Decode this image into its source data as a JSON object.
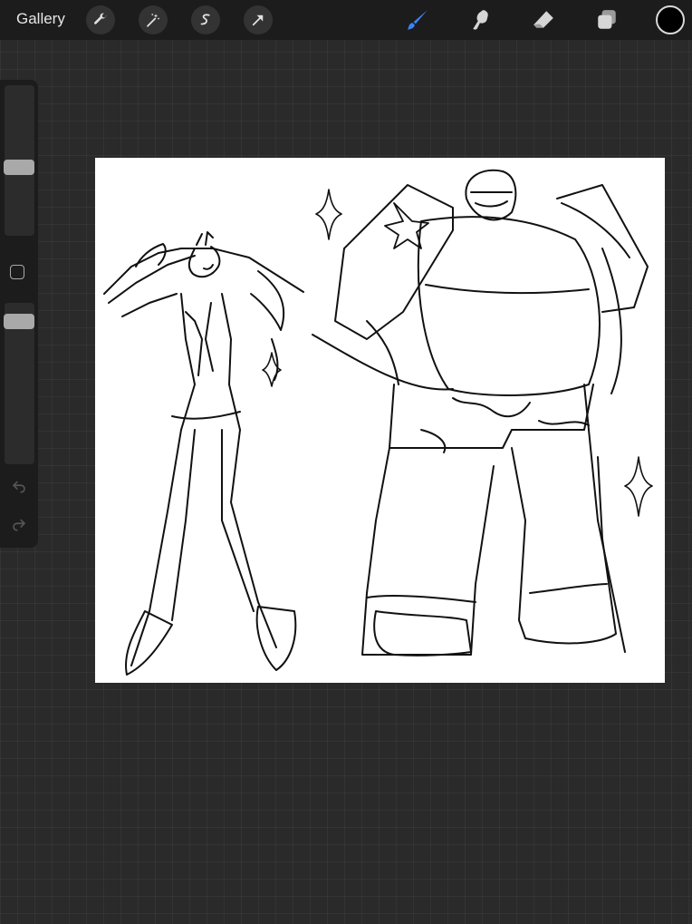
{
  "toolbar": {
    "gallery_label": "Gallery",
    "left_tools": [
      {
        "icon": "wrench-icon"
      },
      {
        "icon": "magic-wand-icon"
      },
      {
        "icon": "selection-icon"
      },
      {
        "icon": "transform-arrow-icon"
      }
    ],
    "right_tools": [
      {
        "icon": "brush-icon",
        "active": true
      },
      {
        "icon": "smudge-icon",
        "active": false
      },
      {
        "icon": "eraser-icon",
        "active": false
      },
      {
        "icon": "layers-icon",
        "active": false
      }
    ],
    "active_tool_color": "#3b82f6",
    "current_color": "#000000"
  },
  "sidebar": {
    "brush_size_level": 0.35,
    "opacity_level": 0.1
  },
  "canvas": {
    "background": "#ffffff",
    "content": "sketch"
  }
}
